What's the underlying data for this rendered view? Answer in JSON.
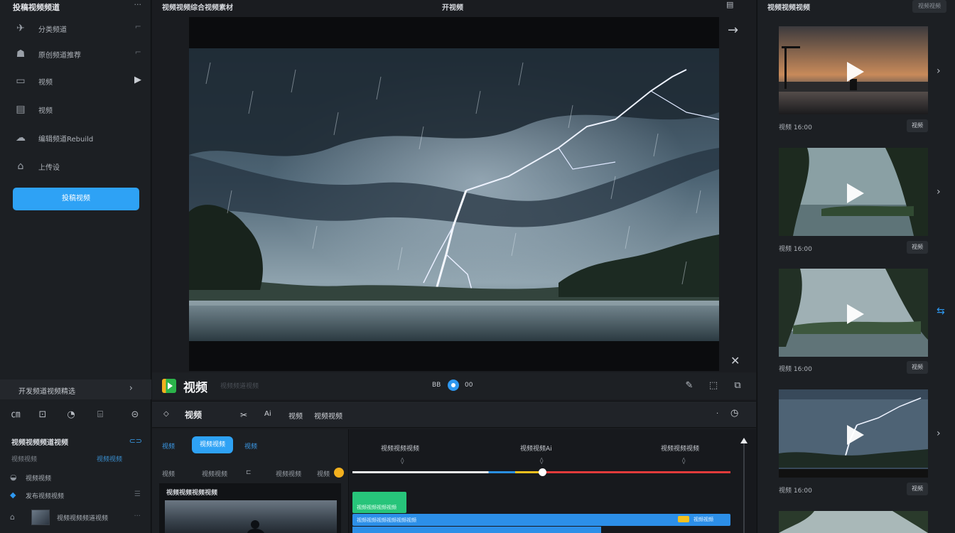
{
  "left": {
    "header_title": "投稿视频频道",
    "header_menu": "···",
    "nav": [
      {
        "icon": "pin-icon",
        "glyph": "✈",
        "label": "分类频道",
        "extra": "⌐"
      },
      {
        "icon": "gallery-icon",
        "glyph": "☗",
        "label": "原创频道推荐",
        "extra": "⌐"
      },
      {
        "icon": "book-icon",
        "glyph": "▭",
        "label": "视频",
        "extra": "▶"
      },
      {
        "icon": "folder-icon",
        "glyph": "▤",
        "label": "视频",
        "extra": ""
      },
      {
        "icon": "cloud-icon",
        "glyph": "☁",
        "label": "编辑频道Rebuild",
        "extra": ""
      },
      {
        "icon": "lock-icon",
        "glyph": "⌂",
        "label": "上传设",
        "extra": ""
      }
    ],
    "primary_button": "投稿视频",
    "section_title": "开发频道视频精选",
    "section_chevron": "›",
    "tools": [
      "㎝",
      "⊡",
      "◔",
      "⌸",
      "⊝"
    ],
    "panel_title": "视频视频频道视频",
    "panel_link": "⊂⊃",
    "panel_row_left": "视频视频",
    "panel_row_right": "视频视频",
    "panel_items": [
      {
        "icon": "eye-icon",
        "glyph": "◒",
        "label": "视频视频",
        "extra": ""
      },
      {
        "icon": "diamond-icon",
        "glyph": "◆",
        "label": "发布视频视频",
        "extra": "☰"
      },
      {
        "icon": "lock-small-icon",
        "glyph": "⌂",
        "label": "视频视频频道视频",
        "extra": "···"
      }
    ]
  },
  "center": {
    "top_title": "视频视频综合视频素材",
    "top_center": "开视频",
    "top_right": "▤",
    "brand": "视频",
    "brand_sub": "视频频道视频",
    "pb_left": "BB",
    "pb_right": "00",
    "ctrl_icons": [
      "✎",
      "⬚",
      "⧉"
    ],
    "tools": {
      "t1": "◇",
      "t2": "视频",
      "t3": "✂",
      "t4": "Ai",
      "t5": "视频",
      "t6": "视频视频",
      "dot": "·",
      "clock": "◷"
    },
    "sub_panel": {
      "tab1": "视频",
      "tab2": "视频视频",
      "tab3": "视频",
      "f1": "视频",
      "f2": "视频视频",
      "f3": "⊏",
      "f4": "视频视频",
      "f5": "视频",
      "card_title": "视频视频视频视频"
    },
    "timeline": {
      "labels": [
        "视频视频视频",
        "视频视频Ai",
        "视频视频视频"
      ],
      "green_clip": "视频视频视频视频",
      "blue_clip": "视频视频视频视频视频视频",
      "blue_clip_end": "视频视频"
    }
  },
  "right": {
    "title": "视频视频视频",
    "button": "视频视频",
    "cards": [
      {
        "date": "视频 16:00",
        "badge": "视频"
      },
      {
        "date": "视频 16:00",
        "badge": "视频"
      },
      {
        "date": "视频 16:00",
        "badge": "视频"
      },
      {
        "date": "视频 16:00",
        "badge": "视频"
      }
    ],
    "arrows": [
      "›",
      "›",
      "⇆",
      "›"
    ]
  }
}
